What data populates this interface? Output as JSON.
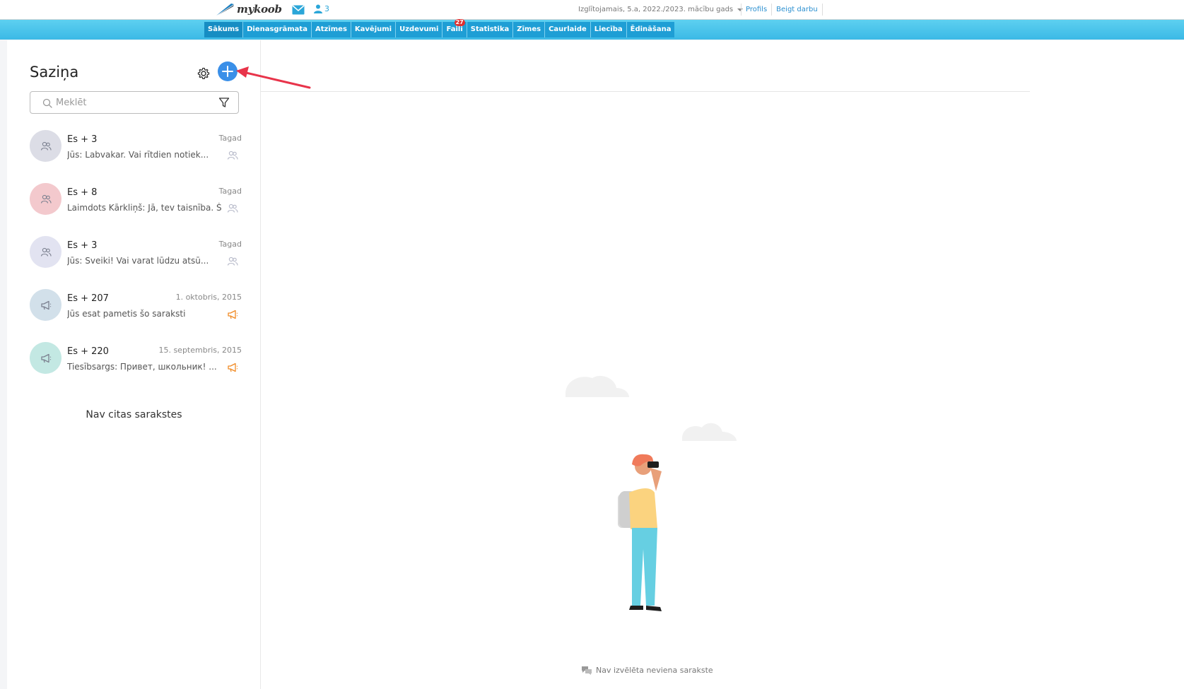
{
  "topbar": {
    "logo_text": "mykoob",
    "mail_icon": "envelope-icon",
    "user_count": "3",
    "user_context": "Izglītojamais, 5.a, 2022./2023. mācību gads",
    "links": [
      "Profils",
      "Beigt darbu"
    ]
  },
  "nav": {
    "items": [
      {
        "label": "Sākums",
        "active": true
      },
      {
        "label": "Dienasgrāmata"
      },
      {
        "label": "Atzīmes"
      },
      {
        "label": "Kavējumi"
      },
      {
        "label": "Uzdevumi"
      },
      {
        "label": "Faili",
        "badge": "27"
      },
      {
        "label": "Statistika"
      },
      {
        "label": "Zīmes"
      },
      {
        "label": "Caurlaide"
      },
      {
        "label": "Liecība"
      },
      {
        "label": "Ēdināšana"
      }
    ]
  },
  "sidebar": {
    "title": "Saziņa",
    "search_placeholder": "Meklēt",
    "conversations": [
      {
        "name": "Es + 3",
        "time": "Tagad",
        "preview": "Jūs: Labvakar. Vai rītdien notiek...",
        "avatar_color": "#dcdde6",
        "avatar_icon": "group-icon",
        "type_icon": "group-icon"
      },
      {
        "name": "Es + 8",
        "time": "Tagad",
        "preview": "Laimdots Kārkliņš: Jā, tev taisnība. Šodien",
        "avatar_color": "#f3c9cd",
        "avatar_icon": "group-icon",
        "type_icon": "group-icon"
      },
      {
        "name": "Es + 3",
        "time": "Tagad",
        "preview": "Jūs: Sveiki! Vai varat lūdzu atsū...",
        "avatar_color": "#e2e3f1",
        "avatar_icon": "group-icon",
        "type_icon": "group-icon"
      },
      {
        "name": "Es + 207",
        "time": "1. oktobris, 2015",
        "preview": "Jūs esat pametis šo sarakstі",
        "avatar_color": "#d2e0ea",
        "avatar_icon": "megaphone-icon",
        "type_icon": "megaphone-icon"
      },
      {
        "name": "Es + 220",
        "time": "15. septembris, 2015",
        "preview": "Tiesībsargs: Привет, школьник! ...",
        "avatar_color": "#c3e8e3",
        "avatar_icon": "megaphone-icon",
        "type_icon": "megaphone-icon"
      }
    ],
    "no_more_text": "Nav citas sarakstes"
  },
  "main": {
    "empty_text": "Nav izvēlēta neviena sarakste"
  },
  "colors": {
    "accent": "#3a8fe8",
    "nav_bg": "#1e9ed5",
    "navbar_gradient_top": "#5dd0f0",
    "link": "#2a8fd0",
    "megaphone": "#f08a24",
    "annotation_arrow": "#e8344a"
  }
}
